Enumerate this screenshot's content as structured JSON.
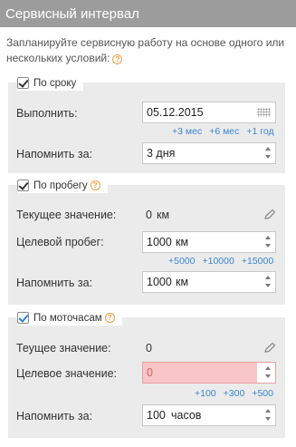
{
  "header": {
    "title": "Сервисный интервал"
  },
  "intro": {
    "text": "Запланируйте сервисную работу на основе одного или нескольких условий:"
  },
  "by_date": {
    "title": "По сроку",
    "checked": true,
    "execute_label": "Выполнить:",
    "execute_value": "05.12.2015",
    "quick_links": [
      "+3 мес",
      "+6 мес",
      "+1 год"
    ],
    "remind_label": "Напомнить за:",
    "remind_value": "3 дня"
  },
  "by_mileage": {
    "title": "По пробегу",
    "checked": true,
    "current_label": "Текущее значение:",
    "current_value": "0",
    "current_unit": "км",
    "target_label": "Целевой пробег:",
    "target_value": "1000",
    "target_unit": "км",
    "quick_links": [
      "+5000",
      "+10000",
      "+15000"
    ],
    "remind_label": "Напомнить за:",
    "remind_value": "1000",
    "remind_unit": "км"
  },
  "by_hours": {
    "title": "По моточасам",
    "checked": true,
    "current_label": "Теущее значение:",
    "current_value": "0",
    "target_label": "Целевое значение:",
    "target_value": "0",
    "quick_links": [
      "+100",
      "+300",
      "+500"
    ],
    "remind_label": "Напомнить за:",
    "remind_value": "100",
    "remind_unit": "часов"
  },
  "colors": {
    "header_bg": "#9c9c9c",
    "section_bg": "#ebebeb",
    "link": "#3b86d1",
    "help": "#f0a040",
    "error_bg": "#f8c6c6"
  }
}
